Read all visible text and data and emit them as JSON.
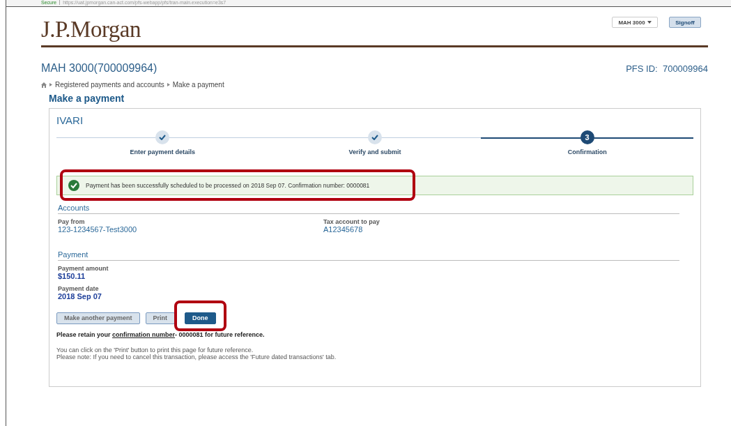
{
  "browser": {
    "security": "Secure",
    "url": "https://uat.jpmorgan.can-act.com/pfs-webapp/pfs/tran-main.execution=e3s7"
  },
  "header": {
    "logo": "J.P.Morgan",
    "user_menu": "MAH 3000",
    "signoff": "Signoff"
  },
  "account_title": "MAH 3000(700009964)",
  "pfs_id": {
    "label": "PFS ID:",
    "value": "700009964"
  },
  "breadcrumb": [
    "Registered payments and accounts",
    "Make a payment"
  ],
  "page_title": "Make a payment",
  "card": {
    "title": "IVARI",
    "steps": [
      {
        "label": "Enter payment details",
        "completed": true,
        "selected": false
      },
      {
        "label": "Verify and submit",
        "completed": true,
        "selected": false
      },
      {
        "label": "Confirmation",
        "completed": false,
        "selected": true,
        "number": "3"
      }
    ],
    "alert": {
      "text": "Payment has been successfully scheduled to be processed on 2018 Sep 07. Confirmation number: 0000081",
      "highlighted": true
    },
    "sections": [
      {
        "title": "Accounts",
        "fields": [
          {
            "label": "Pay from",
            "value": "123-1234567-Test3000",
            "kind": "link"
          },
          {
            "label": "Tax account to pay",
            "value": "A12345678",
            "kind": "link"
          }
        ]
      },
      {
        "title": "Payment",
        "fields": [
          {
            "label": "Payment amount",
            "value": "$150.11",
            "kind": "bold"
          },
          {
            "label": "Payment date",
            "value": "2018 Sep 07",
            "kind": "bold"
          }
        ]
      }
    ],
    "buttons": [
      {
        "label": "Make another payment",
        "primary": false,
        "highlighted": false
      },
      {
        "label": "Print",
        "primary": false,
        "highlighted": false
      },
      {
        "label": "Done",
        "primary": true,
        "highlighted": true
      }
    ],
    "retain": {
      "before": "Please retain your ",
      "link": "confirmation number",
      "after": "- 0000081 for future reference."
    },
    "notes": [
      "You can click on the 'Print' button to print this page for future reference.",
      "Please note: If you need to cancel this transaction, please access the 'Future dated transactions' tab."
    ]
  }
}
